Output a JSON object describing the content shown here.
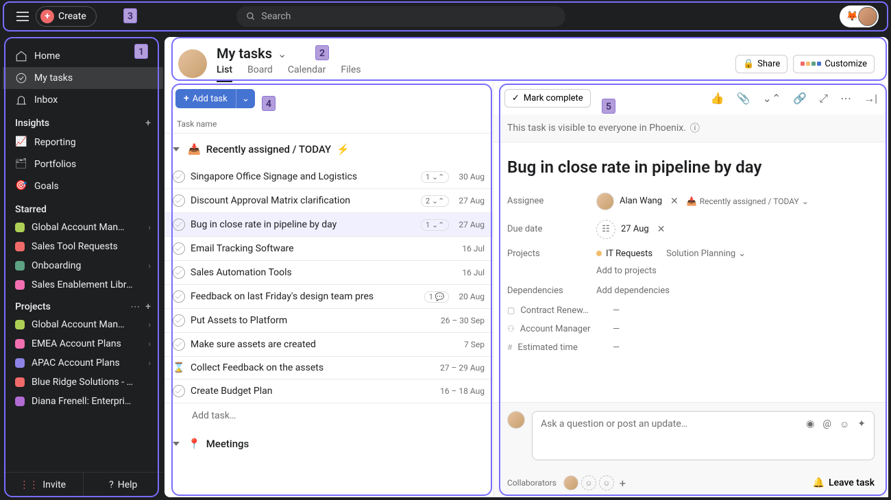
{
  "topbar": {
    "create_label": "Create",
    "search_placeholder": "Search"
  },
  "sidebar": {
    "nav": [
      {
        "label": "Home",
        "icon": "home"
      },
      {
        "label": "My tasks",
        "icon": "check",
        "active": true
      },
      {
        "label": "Inbox",
        "icon": "bell"
      }
    ],
    "insights_label": "Insights",
    "insights": [
      {
        "label": "Reporting"
      },
      {
        "label": "Portfolios"
      },
      {
        "label": "Goals"
      }
    ],
    "starred_label": "Starred",
    "starred": [
      {
        "label": "Global Account Man…",
        "color": "#aecf55",
        "chev": true
      },
      {
        "label": "Sales Tool Requests",
        "color": "#f06a6a"
      },
      {
        "label": "Onboarding",
        "color": "#5da283",
        "chev": true
      },
      {
        "label": "Sales Enablement Library",
        "color": "#f26fb2"
      }
    ],
    "projects_label": "Projects",
    "projects": [
      {
        "label": "Global Account Man…",
        "color": "#aecf55",
        "chev": true
      },
      {
        "label": "EMEA Account Plans",
        "color": "#f26fb2",
        "chev": true
      },
      {
        "label": "APAC Account Plans",
        "color": "#8d84e8",
        "chev": true
      },
      {
        "label": "Blue Ridge Solutions - A…",
        "color": "#f06a6a"
      },
      {
        "label": "Diana Frenell: Enterprise…",
        "color": "#b36bd4"
      }
    ],
    "invite_label": "Invite",
    "help_label": "Help"
  },
  "header": {
    "title": "My tasks",
    "tabs": [
      "List",
      "Board",
      "Calendar",
      "Files"
    ],
    "active_tab": "List",
    "share_label": "Share",
    "customize_label": "Customize"
  },
  "tasklist": {
    "add_task_label": "Add task",
    "column_head": "Task name",
    "sections": [
      {
        "title": "Recently assigned / TODAY",
        "emoji_prefix": "📥",
        "emoji_suffix": "⚡",
        "tasks": [
          {
            "name": "Singapore Office Signage and Logistics",
            "sub": "1",
            "subicon": "subtask",
            "date": "30 Aug"
          },
          {
            "name": "Discount Approval Matrix clarification",
            "sub": "2",
            "subicon": "subtask",
            "date": "27 Aug"
          },
          {
            "name": "Bug in close rate in pipeline by day",
            "sub": "1",
            "subicon": "subtask",
            "date": "27 Aug",
            "selected": true
          },
          {
            "name": "Email Tracking Software",
            "date": "16 Jul"
          },
          {
            "name": "Sales Automation Tools",
            "date": "16 Jul"
          },
          {
            "name": "Feedback on last Friday's design team pres",
            "sub": "1",
            "subicon": "comment",
            "date": "20 Aug"
          },
          {
            "name": "Put Assets to Platform",
            "date": "26 – 30 Sep"
          },
          {
            "name": "Make sure assets are created",
            "date": "7 Sep"
          },
          {
            "name": "Collect Feedback on the assets",
            "date": "27 – 29 Aug",
            "icon": "hourglass"
          },
          {
            "name": "Create Budget Plan",
            "date": "16 – 18 Aug"
          }
        ],
        "add_task_placeholder": "Add task…"
      },
      {
        "title": "Meetings",
        "emoji_prefix": "📍"
      }
    ]
  },
  "detail": {
    "mark_complete_label": "Mark complete",
    "visibility_text": "This task is visible to everyone in Phoenix.",
    "title": "Bug in close rate in pipeline by day",
    "fields": {
      "assignee_label": "Assignee",
      "assignee_name": "Alan Wang",
      "assignee_section": "Recently assigned / TODAY",
      "due_date_label": "Due date",
      "due_date_value": "27 Aug",
      "projects_label": "Projects",
      "project1": "IT Requests",
      "project2": "Solution Planning",
      "add_projects_label": "Add to projects",
      "dependencies_label": "Dependencies",
      "add_dependencies_label": "Add dependencies",
      "custom_fields": [
        {
          "icon": "▢",
          "label": "Contract Renew…",
          "value": "—"
        },
        {
          "icon": "⚇",
          "label": "Account Manager",
          "value": "—"
        },
        {
          "icon": "#",
          "label": "Estimated time",
          "value": "—"
        }
      ]
    },
    "comment_placeholder": "Ask a question or post an update…",
    "collaborators_label": "Collaborators",
    "leave_task_label": "Leave task"
  },
  "badges": {
    "b1": "1",
    "b2": "2",
    "b3": "3",
    "b4": "4",
    "b5": "5"
  }
}
